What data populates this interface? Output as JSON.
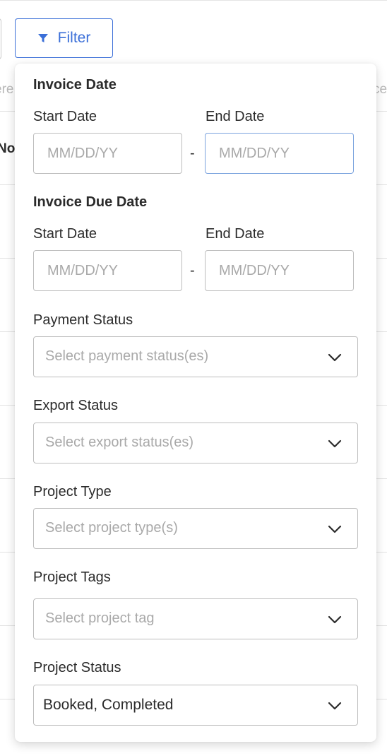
{
  "toolbar": {
    "filter_label": "Filter"
  },
  "background": {
    "header_fragment_left": "ere",
    "header_fragment_right": "ce",
    "row_fragment": "No"
  },
  "filter_panel": {
    "invoice_date": {
      "title": "Invoice Date",
      "start_label": "Start Date",
      "end_label": "End Date",
      "start_placeholder": "MM/DD/YY",
      "end_placeholder": "MM/DD/YY",
      "separator": "-"
    },
    "invoice_due_date": {
      "title": "Invoice Due Date",
      "start_label": "Start Date",
      "end_label": "End Date",
      "start_placeholder": "MM/DD/YY",
      "end_placeholder": "MM/DD/YY",
      "separator": "-"
    },
    "payment_status": {
      "label": "Payment Status",
      "placeholder": "Select payment status(es)"
    },
    "export_status": {
      "label": "Export Status",
      "placeholder": "Select export status(es)"
    },
    "project_type": {
      "label": "Project Type",
      "placeholder": "Select project type(s)"
    },
    "project_tags": {
      "label": "Project Tags",
      "placeholder": "Select project tag"
    },
    "project_status": {
      "label": "Project Status",
      "value": "Booked, Completed"
    }
  },
  "colors": {
    "accent": "#3b6fd8",
    "focus_border": "#7ba3de",
    "input_border": "#bdbdbd",
    "placeholder": "#a9a9a9"
  },
  "icons": {
    "filter": "filter-funnel-icon",
    "dropdown": "chevron-down-icon"
  }
}
